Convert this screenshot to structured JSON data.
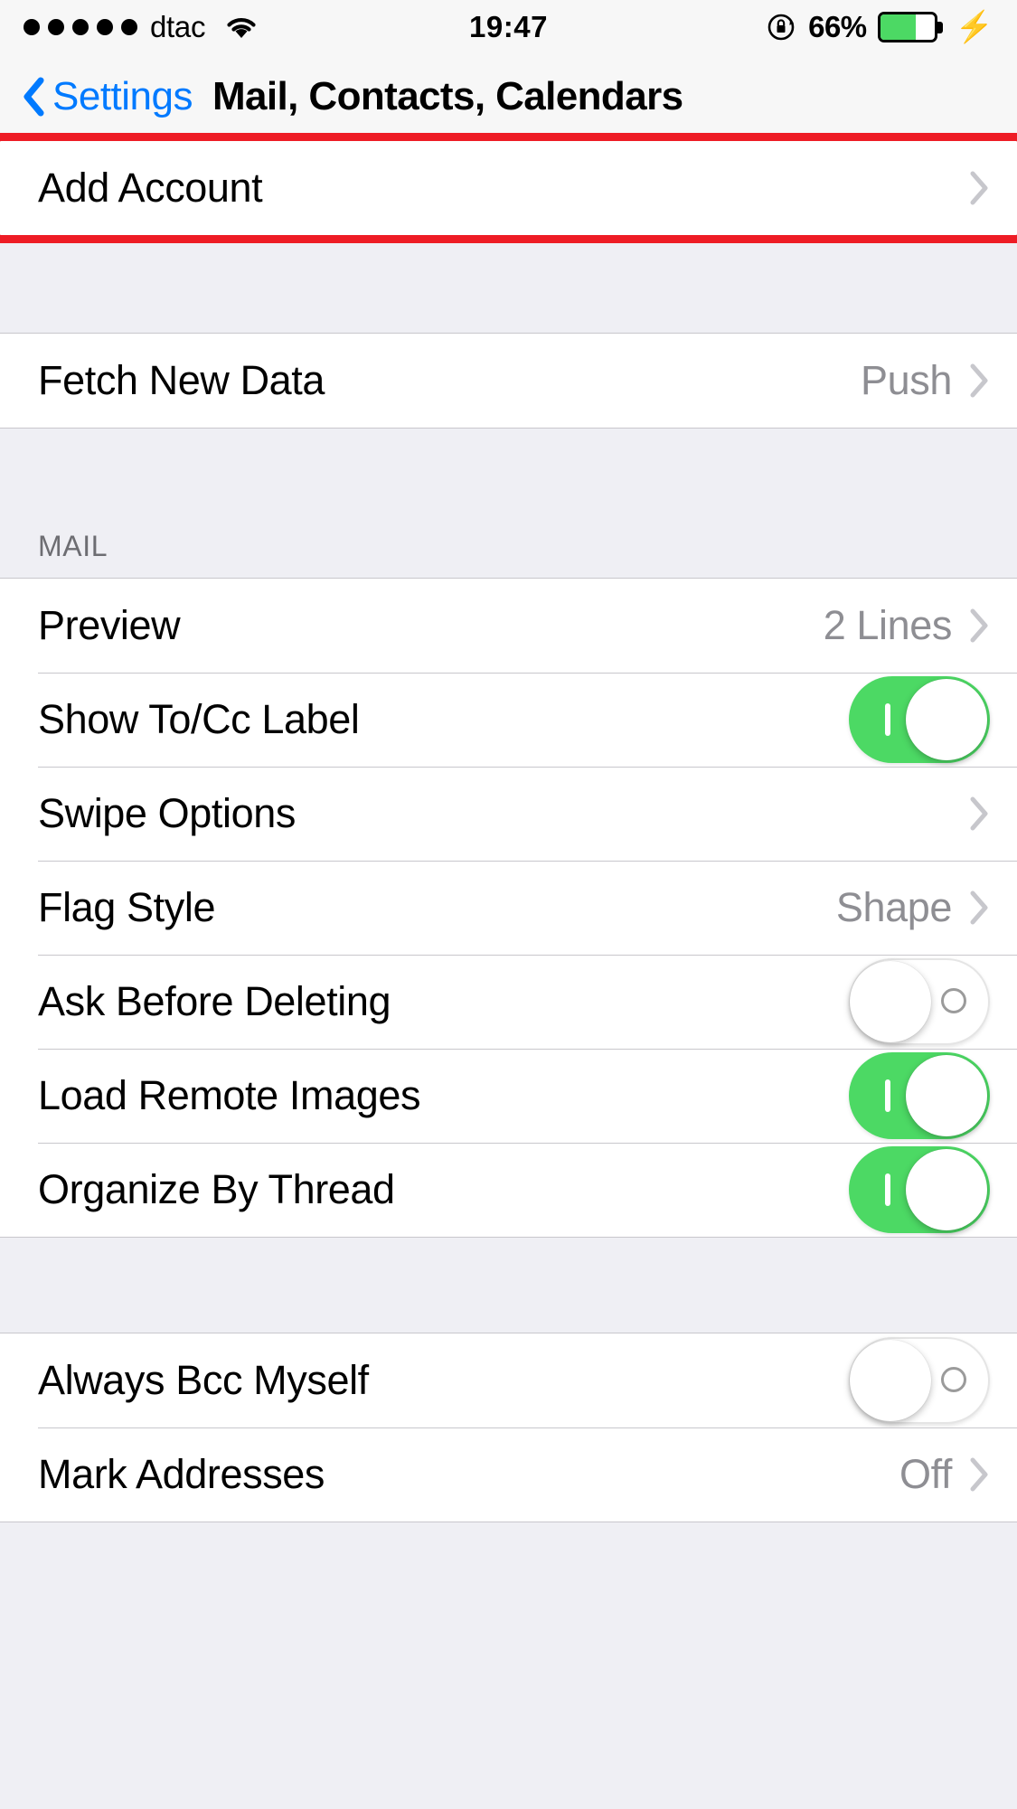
{
  "status_bar": {
    "signal_dots": 5,
    "carrier": "dtac",
    "wifi_icon": "wifi-icon",
    "time": "19:47",
    "rotation_lock_icon": "rotation-lock-icon",
    "battery_percent": "66%",
    "battery_level": 66,
    "battery_color": "#4cd964",
    "charging_icon": "lightning-bolt-icon"
  },
  "nav_bar": {
    "back_label": "Settings",
    "back_icon": "chevron-left-icon",
    "title": "Mail, Contacts, Calendars",
    "back_color": "#007aff"
  },
  "highlight": {
    "color": "#ee1c25",
    "target": "Add Account"
  },
  "sections": [
    {
      "header": "",
      "rows": [
        {
          "label": "Add Account",
          "type": "disclosure",
          "value": "",
          "icon": "chevron-right-icon"
        }
      ]
    },
    {
      "header": "",
      "rows": [
        {
          "label": "Fetch New Data",
          "type": "disclosure",
          "value": "Push",
          "icon": "chevron-right-icon"
        }
      ]
    },
    {
      "header": "MAIL",
      "rows": [
        {
          "label": "Preview",
          "type": "disclosure",
          "value": "2 Lines",
          "icon": "chevron-right-icon"
        },
        {
          "label": "Show To/Cc Label",
          "type": "switch",
          "value": "on"
        },
        {
          "label": "Swipe Options",
          "type": "disclosure",
          "value": "",
          "icon": "chevron-right-icon"
        },
        {
          "label": "Flag Style",
          "type": "disclosure",
          "value": "Shape",
          "icon": "chevron-right-icon"
        },
        {
          "label": "Ask Before Deleting",
          "type": "switch",
          "value": "off"
        },
        {
          "label": "Load Remote Images",
          "type": "switch",
          "value": "on"
        },
        {
          "label": "Organize By Thread",
          "type": "switch",
          "value": "on"
        }
      ]
    },
    {
      "header": "",
      "rows": [
        {
          "label": "Always Bcc Myself",
          "type": "switch",
          "value": "off"
        },
        {
          "label": "Mark Addresses",
          "type": "disclosure",
          "value": "Off",
          "icon": "chevron-right-icon"
        }
      ]
    }
  ]
}
